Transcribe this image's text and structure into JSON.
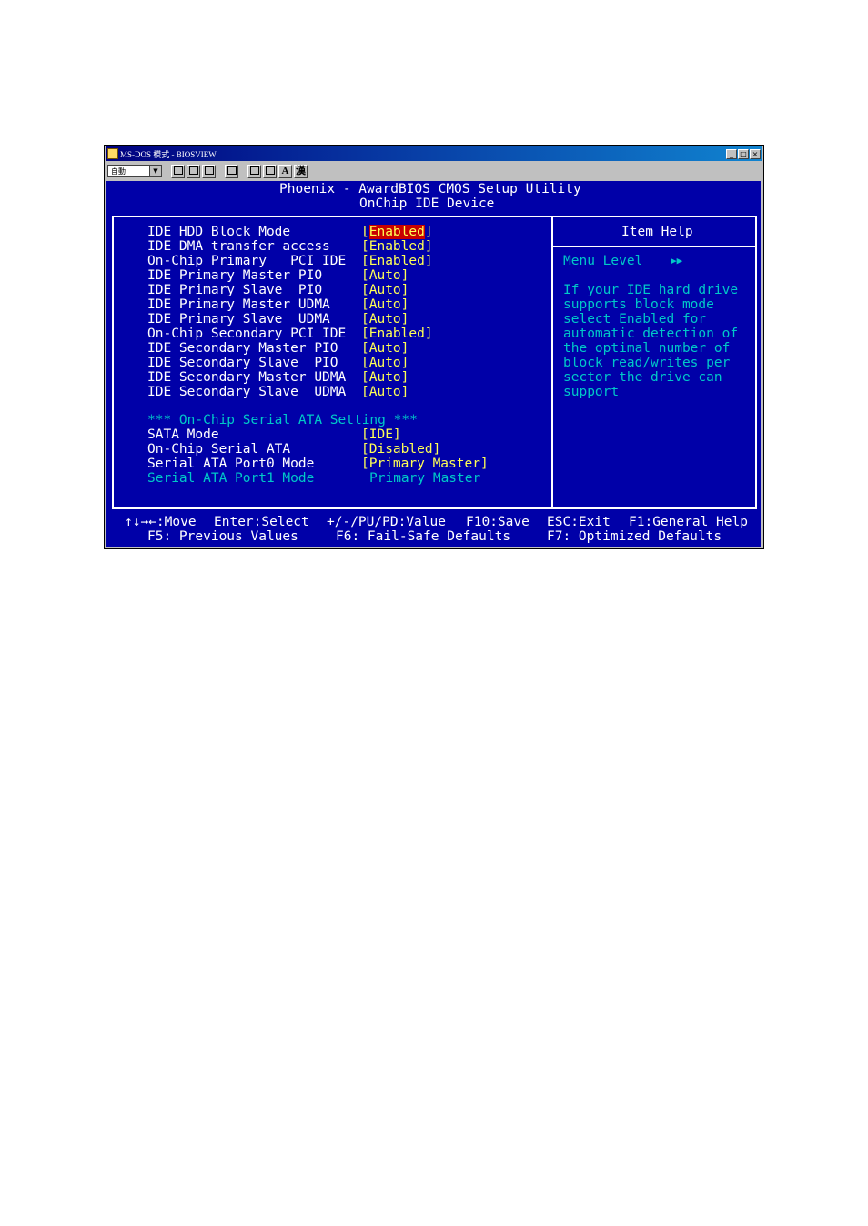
{
  "window": {
    "title": "MS-DOS 模式 - BIOSVIEW",
    "font_select": "自動",
    "dropdown_icon": "chevron-down-icon",
    "buttons": [
      "minimize-icon",
      "maximize-icon",
      "close-icon"
    ],
    "toolbar_text_buttons": [
      "A",
      "漢"
    ]
  },
  "bios": {
    "header_line1": "Phoenix - AwardBIOS CMOS Setup Utility",
    "header_line2": "OnChip IDE Device",
    "items": [
      {
        "label": "IDE HDD Block Mode",
        "value": "Enabled",
        "selected": true
      },
      {
        "label": "IDE DMA transfer access",
        "value": "Enabled"
      },
      {
        "label": "On-Chip Primary   PCI IDE",
        "value": "Enabled"
      },
      {
        "label": "IDE Primary Master PIO",
        "value": "Auto"
      },
      {
        "label": "IDE Primary Slave  PIO",
        "value": "Auto"
      },
      {
        "label": "IDE Primary Master UDMA",
        "value": "Auto"
      },
      {
        "label": "IDE Primary Slave  UDMA",
        "value": "Auto"
      },
      {
        "label": "On-Chip Secondary PCI IDE",
        "value": "Enabled"
      },
      {
        "label": "IDE Secondary Master PIO",
        "value": "Auto"
      },
      {
        "label": "IDE Secondary Slave  PIO",
        "value": "Auto"
      },
      {
        "label": "IDE Secondary Master UDMA",
        "value": "Auto"
      },
      {
        "label": "IDE Secondary Slave  UDMA",
        "value": "Auto"
      }
    ],
    "section_title": "*** On-Chip Serial ATA Setting ***",
    "sata_items": [
      {
        "label": "SATA Mode",
        "value": "IDE"
      },
      {
        "label": "On-Chip Serial ATA",
        "value": "Disabled"
      },
      {
        "label": "Serial ATA Port0 Mode",
        "value": "Primary Master"
      }
    ],
    "sata_disabled_item": {
      "label": "Serial ATA Port1 Mode",
      "value": "Primary Master"
    },
    "help": {
      "title": "Item Help",
      "menu_level": "Menu Level",
      "menu_level_arrows": "▶▶",
      "lines": [
        "If your IDE hard drive",
        "supports block mode",
        "select Enabled for",
        "automatic detection of",
        "the optimal number of",
        "block read/writes per",
        "sector the drive can",
        "support"
      ]
    },
    "footer": {
      "move": "↑↓→←:Move",
      "select": "Enter:Select",
      "value": "+/-/PU/PD:Value",
      "save": "F10:Save",
      "exit": "ESC:Exit",
      "general_help": "F1:General Help",
      "previous": "F5: Previous Values",
      "failsafe": "F6: Fail-Safe Defaults",
      "optimized": "F7: Optimized Defaults"
    }
  },
  "colors": {
    "background": "#0000a8",
    "text": "#ffffff",
    "value": "#ffff55",
    "section": "#00c8c8",
    "highlight": "#c80000"
  }
}
